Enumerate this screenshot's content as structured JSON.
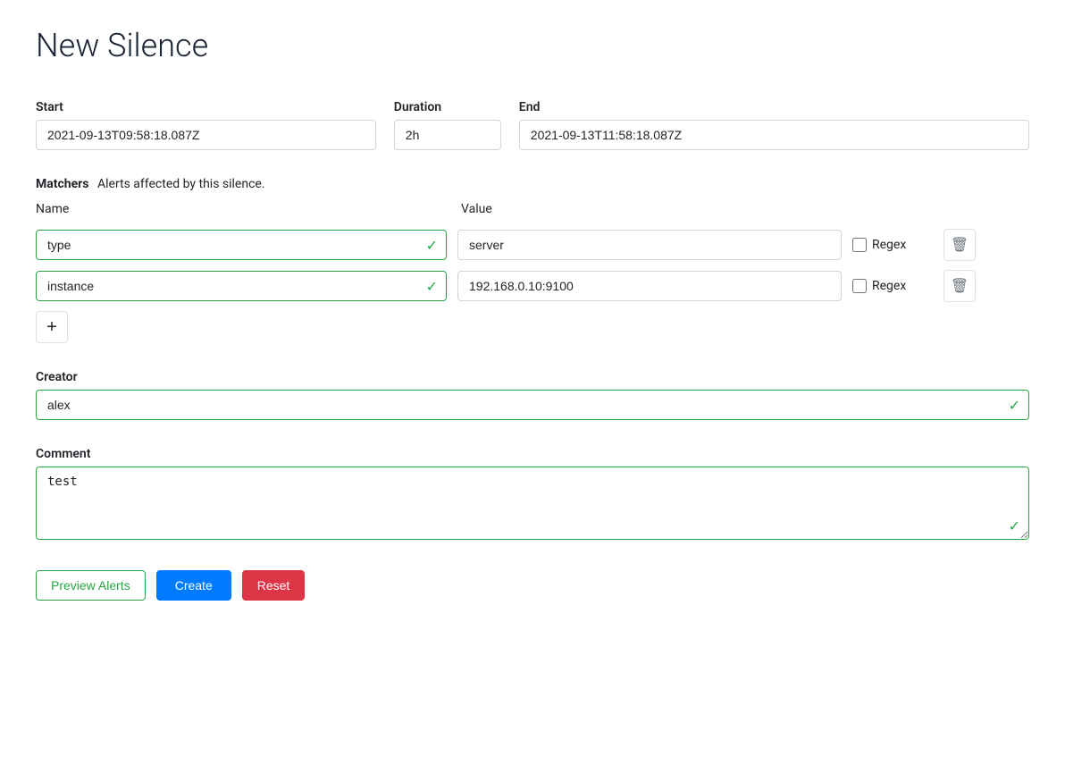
{
  "page": {
    "title": "New Silence"
  },
  "start": {
    "label": "Start",
    "value": "2021-09-13T09:58:18.087Z"
  },
  "duration": {
    "label": "Duration",
    "value": "2h"
  },
  "end": {
    "label": "End",
    "value": "2021-09-13T11:58:18.087Z"
  },
  "matchers": {
    "label": "Matchers",
    "description": "Alerts affected by this silence.",
    "name_col": "Name",
    "value_col": "Value",
    "rows": [
      {
        "name": "type",
        "value": "server",
        "regex": false,
        "regex_label": "Regex"
      },
      {
        "name": "instance",
        "value": "192.168.0.10:9100",
        "regex": false,
        "regex_label": "Regex"
      }
    ],
    "add_button_label": "+"
  },
  "creator": {
    "label": "Creator",
    "value": "alex"
  },
  "comment": {
    "label": "Comment",
    "value": "test"
  },
  "buttons": {
    "preview": "Preview Alerts",
    "create": "Create",
    "reset": "Reset"
  }
}
